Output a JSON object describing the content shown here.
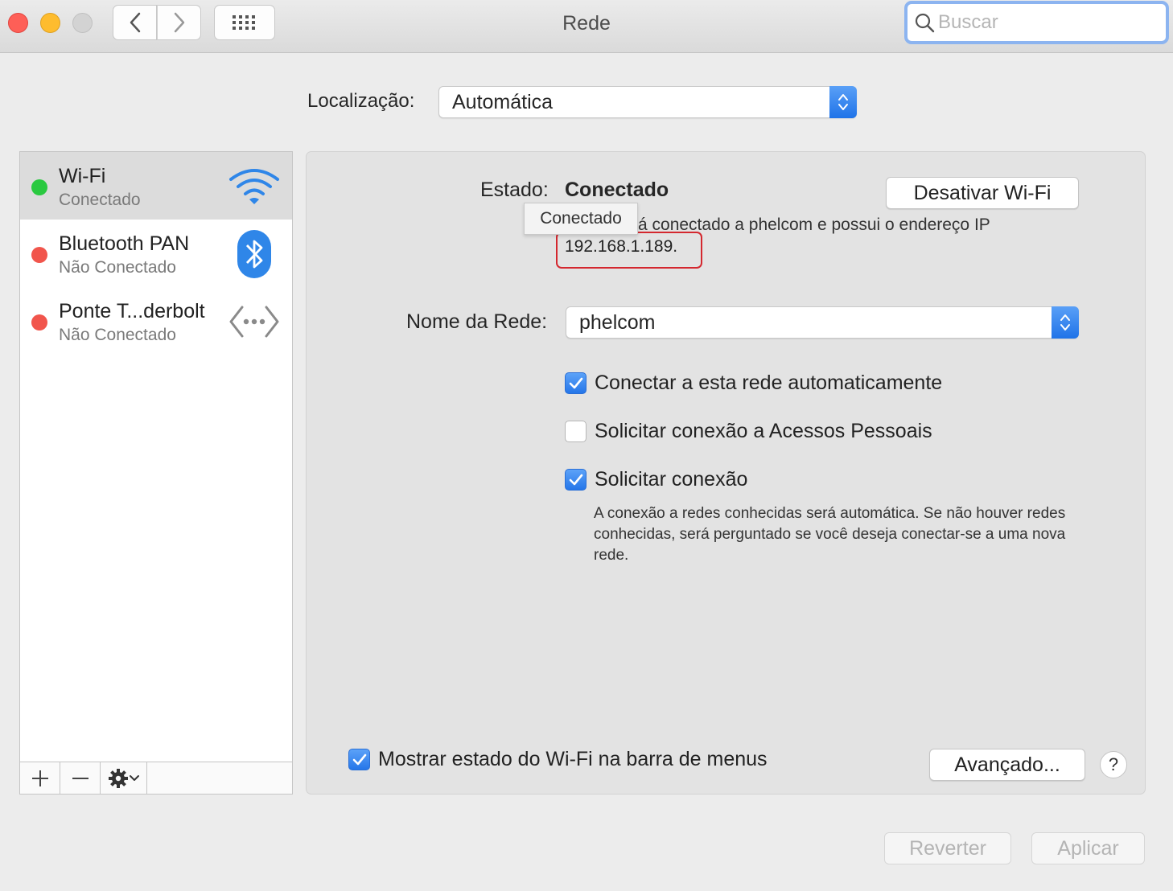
{
  "window": {
    "title": "Rede"
  },
  "search": {
    "placeholder": "Buscar"
  },
  "location": {
    "label": "Localização:",
    "value": "Automática"
  },
  "services": [
    {
      "name": "Wi-Fi",
      "status": "Conectado",
      "status_color": "#2ac940",
      "icon": "wifi-icon"
    },
    {
      "name": "Bluetooth PAN",
      "status": "Não Conectado",
      "status_color": "#f1554c",
      "icon": "bluetooth-icon"
    },
    {
      "name": "Ponte T...derbolt",
      "status": "Não Conectado",
      "status_color": "#f1554c",
      "icon": "thunderbolt-bridge-icon"
    }
  ],
  "detail": {
    "state_label": "Estado:",
    "state_value": "Conectado",
    "toggle_button": "Desativar Wi-Fi",
    "tooltip": "Conectado",
    "description_visible": "á conectado a phelcom e possui o endereço IP",
    "ip": "192.168.1.189.",
    "network_label": "Nome da Rede:",
    "network_value": "phelcom",
    "options": [
      {
        "label": "Conectar a esta rede automaticamente",
        "checked": true
      },
      {
        "label": "Solicitar conexão a Acessos Pessoais",
        "checked": false
      },
      {
        "label": "Solicitar conexão",
        "checked": true
      }
    ],
    "note": "A conexão a redes conhecidas será automática. Se não houver redes conhecidas, será perguntado se você deseja conectar-se a uma nova rede.",
    "menu_bar_option": {
      "label": "Mostrar estado do Wi-Fi na barra de menus",
      "checked": true
    },
    "advanced_button": "Avançado...",
    "help_label": "?"
  },
  "footer": {
    "revert": "Reverter",
    "apply": "Aplicar"
  },
  "colors": {
    "accent": "#2576e9",
    "highlight": "#d4282f"
  }
}
